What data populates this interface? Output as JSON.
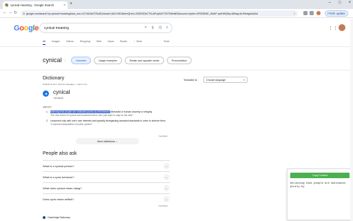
{
  "browser": {
    "tab_title": "cynical meaning - Google Search",
    "tab_close": "×",
    "new_tab": "+",
    "window_controls": [
      "–",
      "□",
      "×"
    ],
    "url": "google.com/search?q=cynical+meaning&sca_esv=4174d19a7f76c811&sxsrf=ADLYWIJ6wImQHoLL03ZKDDbC7SLAPcly6cF7Z07D8mNEl&source=hp&ei=vP93ZlE8K_lf4ckP-ryAHWQfiq=&iflsig=AL9hbdgAAAAA",
    "finish_update": "Finish update",
    "back": "←",
    "forward": "→",
    "reload": "↻",
    "star": "☆"
  },
  "search": {
    "logo": [
      "G",
      "o",
      "o",
      "g",
      "l",
      "e"
    ],
    "logo_colors": [
      "#4285f4",
      "#ea4335",
      "#fbbc05",
      "#4285f4",
      "#34a853",
      "#ea4335"
    ],
    "query": "cynical meaning",
    "clear": "×",
    "mic": "🎙",
    "lens": "◎",
    "submit": "⌕",
    "apps": "⋮⋮"
  },
  "tabs": [
    "All",
    "Images",
    "Videos",
    "Shopping",
    "Web",
    "News",
    "Books",
    "⋮ More"
  ],
  "tools": "Tools",
  "header": {
    "word": "cynical",
    "info": "⋮",
    "chips": [
      "Overview",
      "Usage examples",
      "Similar and opposite words",
      "Pronunciation"
    ]
  },
  "dictionary": {
    "title": "Dictionary",
    "subtitle": "Definitions from Oxford Languages · Learn more",
    "word": "cynical",
    "pronunciation": "/ˈsinək(ə)l/",
    "pos": "adjective",
    "defs": [
      {
        "num": "1.",
        "highlighted": "believing that people are motivated purely by self-interest;",
        "rest": " distrustful of human sincerity or integrity.",
        "example": "\"the new breed of cynical and hardened teens who just want to stay on the dole\""
      },
      {
        "num": "2.",
        "text": "concerned only with one's own interests and typically disregarding accepted standards in order to achieve them.",
        "example": "\"a cynical manipulation of public opinion\""
      }
    ],
    "feedback": "Feedback",
    "more_definitions": "More definitions ⌄"
  },
  "translate": {
    "label": "Translate to",
    "select": "Choose language",
    "arrow": "▾"
  },
  "paa": {
    "title": "People also ask",
    "menu": "⋮",
    "items": [
      "What is a cynical person?",
      "What is a cynic behavior?",
      "What does cynical mean slang?",
      "Does cynic mean selfish?"
    ],
    "chevron": "⌄",
    "feedback": "Feedback"
  },
  "source": {
    "name": "Cambridge Dictionary"
  },
  "extension_popup": {
    "button": "Copy Content",
    "text": "believing that people are motivated purely by"
  }
}
